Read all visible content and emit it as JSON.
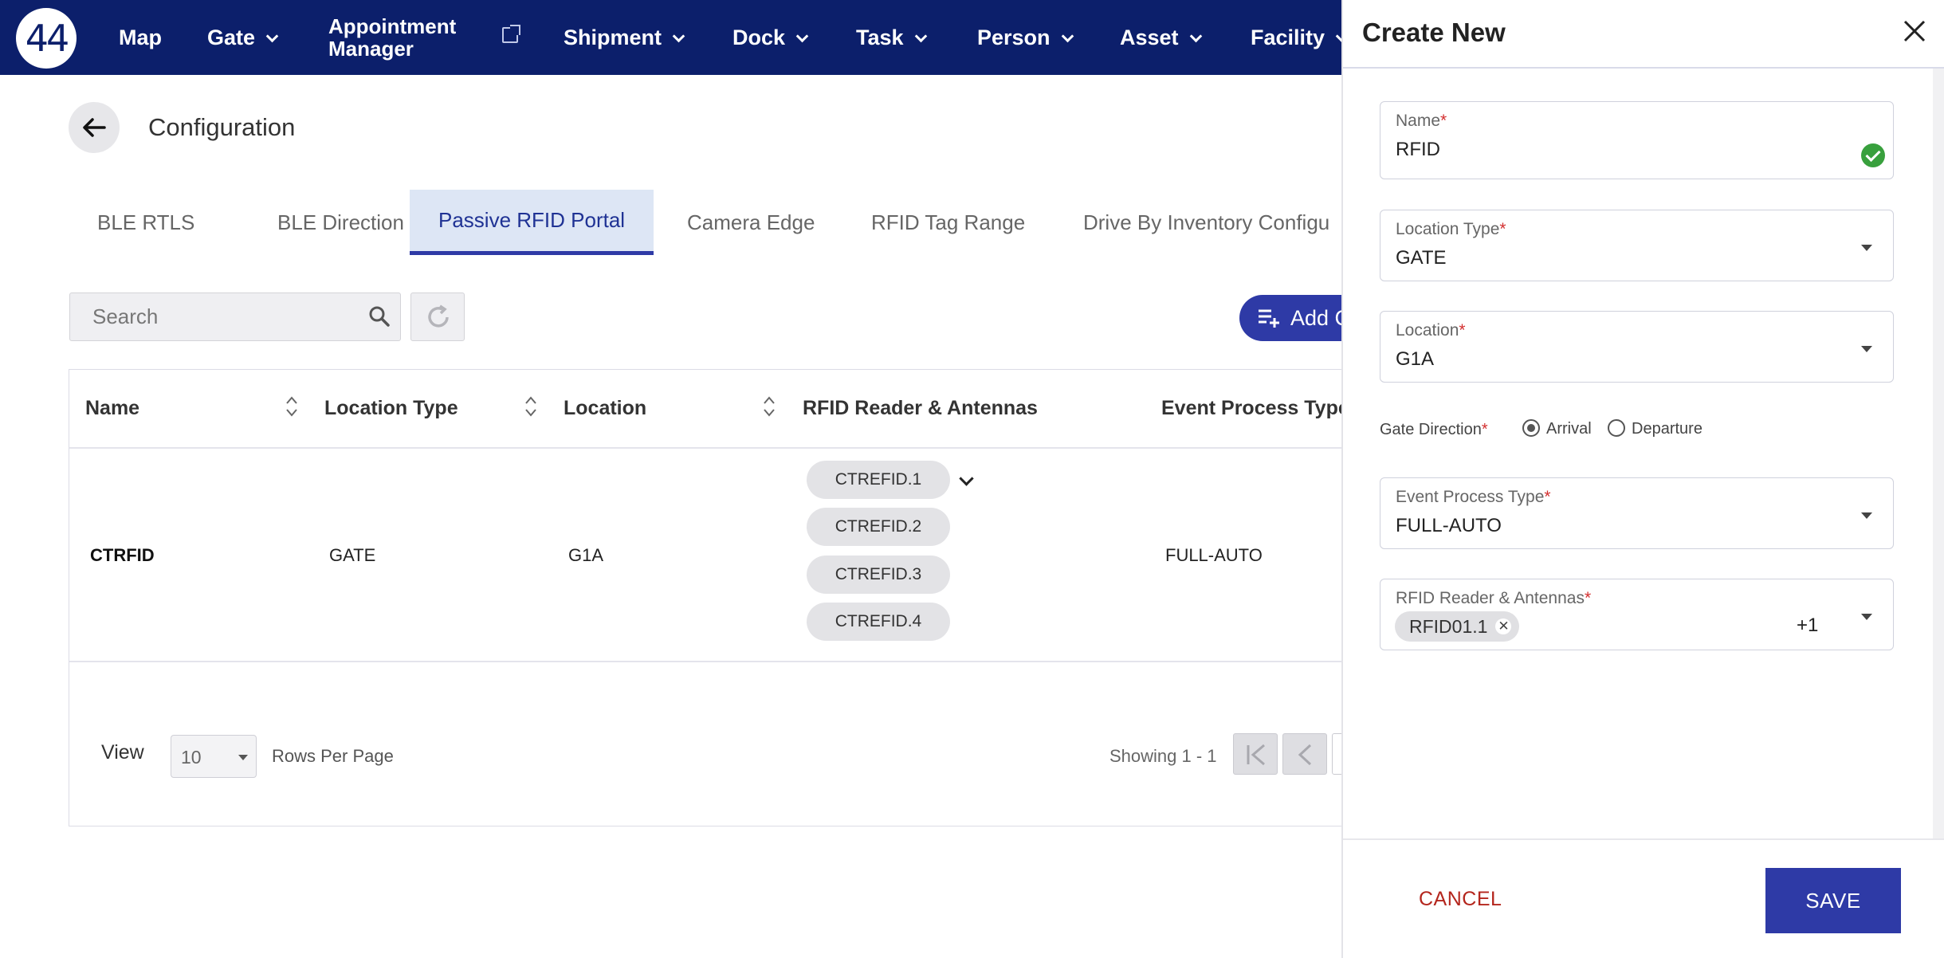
{
  "nav": {
    "logo": "44",
    "items": [
      {
        "label": "Map"
      },
      {
        "label": "Gate"
      },
      {
        "label": "Appointment",
        "label2": "Manager"
      },
      {
        "label": "Shipment"
      },
      {
        "label": "Dock"
      },
      {
        "label": "Task"
      },
      {
        "label": "Person"
      },
      {
        "label": "Asset"
      },
      {
        "label": "Facility"
      }
    ]
  },
  "page": {
    "title": "Configuration"
  },
  "tabs": [
    {
      "label": "BLE RTLS"
    },
    {
      "label": "BLE Direction"
    },
    {
      "label": "Passive RFID Portal",
      "active": true
    },
    {
      "label": "Camera Edge"
    },
    {
      "label": "RFID Tag Range"
    },
    {
      "label": "Drive By Inventory Configu"
    }
  ],
  "toolbar": {
    "search_placeholder": "Search",
    "add_label": "Add C"
  },
  "table": {
    "columns": [
      "Name",
      "Location Type",
      "Location",
      "RFID Reader & Antennas",
      "Event Process Type"
    ],
    "rows": [
      {
        "name": "CTRFID",
        "location_type": "GATE",
        "location": "G1A",
        "antennas": [
          "CTREFID.1",
          "CTREFID.2",
          "CTREFID.3",
          "CTREFID.4"
        ],
        "event_process_type": "FULL-AUTO"
      }
    ]
  },
  "pagination": {
    "view_label": "View",
    "rows_per_page": "10",
    "rows_per_page_label": "Rows Per Page",
    "showing": "Showing 1 - 1"
  },
  "drawer": {
    "title": "Create New",
    "fields": {
      "name": {
        "label": "Name",
        "value": "RFID"
      },
      "location_type": {
        "label": "Location Type",
        "value": "GATE"
      },
      "location": {
        "label": "Location",
        "value": "G1A"
      },
      "gate_direction": {
        "label": "Gate Direction",
        "options": [
          "Arrival",
          "Departure"
        ],
        "selected": "Arrival"
      },
      "event_process_type": {
        "label": "Event Process Type",
        "value": "FULL-AUTO"
      },
      "rfid_reader": {
        "label": "RFID Reader & Antennas",
        "chip": "RFID01.1",
        "more": "+1"
      }
    },
    "cancel_label": "CANCEL",
    "save_label": "SAVE"
  },
  "colors": {
    "nav_bg": "#0c1f6b",
    "primary": "#2e3aa6",
    "success": "#38a03d",
    "danger": "#b4261d"
  }
}
